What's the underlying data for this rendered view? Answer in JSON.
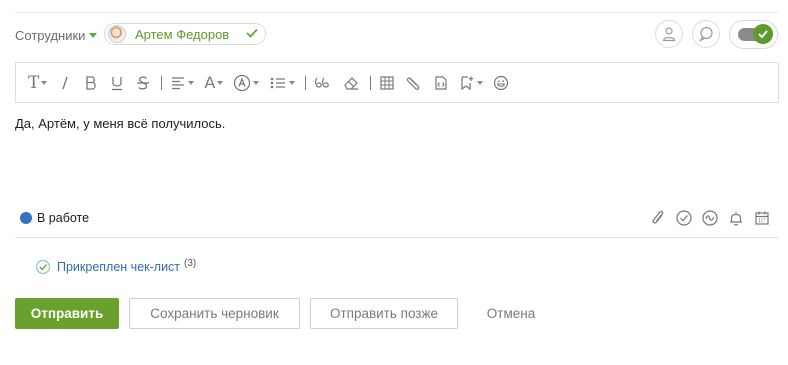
{
  "recipients": {
    "label": "Сотрудники",
    "chip_name": "Артем Федоров"
  },
  "toolbar": {
    "icons": [
      "font-size-icon",
      "italic-icon",
      "bold-icon",
      "underline-icon",
      "strikethrough-icon",
      "align-icon",
      "font-color-icon",
      "background-color-icon",
      "list-icon",
      "quote-icon",
      "clear-format-icon",
      "table-icon",
      "link-icon",
      "code-icon",
      "insert-icon",
      "emoji-icon"
    ],
    "labels": {
      "font_size": "T",
      "font_color": "A"
    }
  },
  "editor": {
    "text": "Да, Артём, у меня всё получилось."
  },
  "status": {
    "label": "В работе",
    "color": "#2f73c1"
  },
  "attachments_icons": [
    "paperclip-icon",
    "check-circle-icon",
    "wave-icon",
    "bell-icon",
    "calendar-icon"
  ],
  "checklist": {
    "label": "Прикреплен чек-лист",
    "count": "(3)"
  },
  "buttons": {
    "send": "Отправить",
    "save_draft": "Сохранить черновик",
    "send_later": "Отправить позже",
    "cancel": "Отмена"
  },
  "colors": {
    "accent": "#68a22d",
    "link": "#2f6db0"
  }
}
